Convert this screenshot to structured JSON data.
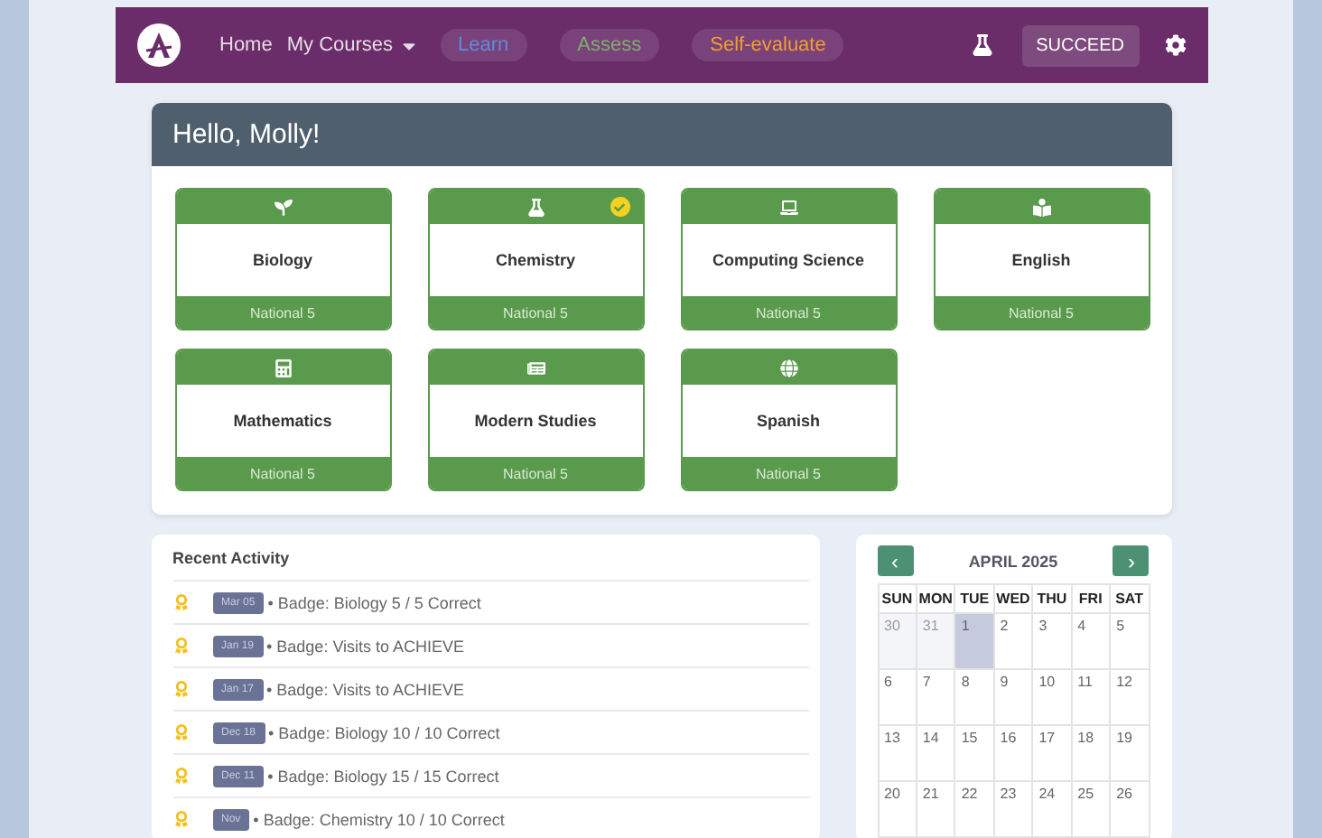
{
  "navbar": {
    "links": [
      {
        "label": "Home",
        "kind": "plain",
        "dropdown": false
      },
      {
        "label": "My Courses",
        "kind": "plain",
        "dropdown": true
      },
      {
        "label": "Learn",
        "kind": "pill",
        "color": "#5b8de0"
      },
      {
        "label": "Assess",
        "kind": "pill",
        "color": "#7fae6e"
      },
      {
        "label": "Self-evaluate",
        "kind": "pill",
        "color": "#f0a030"
      }
    ],
    "user_button": "SUCCEED"
  },
  "greeting": "Hello, Molly!",
  "courses": [
    {
      "name": "Biology",
      "level": "National 5",
      "completed": false
    },
    {
      "name": "Chemistry",
      "level": "National 5",
      "completed": true
    },
    {
      "name": "Computing Science",
      "level": "National 5",
      "completed": false
    },
    {
      "name": "English",
      "level": "National 5",
      "completed": false
    },
    {
      "name": "Mathematics",
      "level": "National 5",
      "completed": false
    },
    {
      "name": "Modern Studies",
      "level": "National 5",
      "completed": false
    },
    {
      "name": "Spanish",
      "level": "National 5",
      "completed": false
    }
  ],
  "recent_activity": {
    "title": "Recent Activity",
    "items": [
      {
        "date": "Mar 05",
        "text": "• Badge: Biology 5 / 5 Correct"
      },
      {
        "date": "Jan 19",
        "text": "• Badge: Visits to ACHIEVE"
      },
      {
        "date": "Jan 17",
        "text": "• Badge: Visits to ACHIEVE"
      },
      {
        "date": "Dec 18",
        "text": "• Badge: Biology 10 / 10 Correct"
      },
      {
        "date": "Dec 11",
        "text": "• Badge: Biology 15 / 15 Correct"
      },
      {
        "date": "Nov",
        "text": "• Badge: Chemistry 10 / 10 Correct"
      }
    ]
  },
  "calendar": {
    "prev": "‹",
    "next": "›",
    "month": "APRIL 2025",
    "weekdays": [
      "SUN",
      "MON",
      "TUE",
      "WED",
      "THU",
      "FRI",
      "SAT"
    ],
    "weeks": [
      [
        {
          "day": "30",
          "outside": true,
          "selected": false
        },
        {
          "day": "31",
          "outside": true,
          "selected": false
        },
        {
          "day": "1",
          "outside": false,
          "selected": true
        },
        {
          "day": "2",
          "outside": false,
          "selected": false
        },
        {
          "day": "3",
          "outside": false,
          "selected": false
        },
        {
          "day": "4",
          "outside": false,
          "selected": false
        },
        {
          "day": "5",
          "outside": false,
          "selected": false
        }
      ],
      [
        {
          "day": "6",
          "outside": false,
          "selected": false
        },
        {
          "day": "7",
          "outside": false,
          "selected": false
        },
        {
          "day": "8",
          "outside": false,
          "selected": false
        },
        {
          "day": "9",
          "outside": false,
          "selected": false
        },
        {
          "day": "10",
          "outside": false,
          "selected": false
        },
        {
          "day": "11",
          "outside": false,
          "selected": false
        },
        {
          "day": "12",
          "outside": false,
          "selected": false
        }
      ],
      [
        {
          "day": "13",
          "outside": false,
          "selected": false
        },
        {
          "day": "14",
          "outside": false,
          "selected": false
        },
        {
          "day": "15",
          "outside": false,
          "selected": false
        },
        {
          "day": "16",
          "outside": false,
          "selected": false
        },
        {
          "day": "17",
          "outside": false,
          "selected": false
        },
        {
          "day": "18",
          "outside": false,
          "selected": false
        },
        {
          "day": "19",
          "outside": false,
          "selected": false
        }
      ],
      [
        {
          "day": "20",
          "outside": false,
          "selected": false
        },
        {
          "day": "21",
          "outside": false,
          "selected": false
        },
        {
          "day": "22",
          "outside": false,
          "selected": false
        },
        {
          "day": "23",
          "outside": false,
          "selected": false
        },
        {
          "day": "24",
          "outside": false,
          "selected": false
        },
        {
          "day": "25",
          "outside": false,
          "selected": false
        },
        {
          "day": "26",
          "outside": false,
          "selected": false
        }
      ]
    ]
  }
}
